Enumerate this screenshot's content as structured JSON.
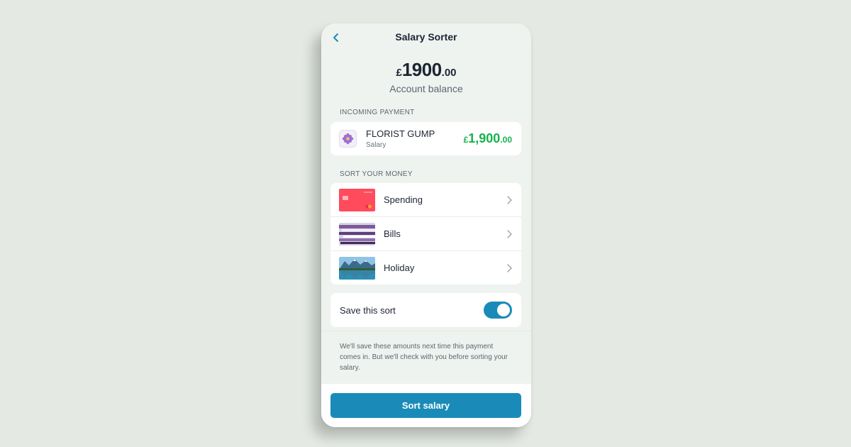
{
  "header": {
    "title": "Salary Sorter",
    "back_icon": "chevron-left-icon"
  },
  "balance": {
    "currency": "£",
    "whole": "1900",
    "pence": ".00",
    "label": "Account balance"
  },
  "incoming": {
    "section_label": "INCOMING PAYMENT",
    "payee": "FLORIST GUMP",
    "category": "Salary",
    "icon": "flower-icon",
    "amount_currency": "£",
    "amount_whole": "1,900",
    "amount_pence": ".00",
    "amount_color": "#16b24c"
  },
  "sort": {
    "section_label": "SORT YOUR MONEY",
    "items": [
      {
        "label": "Spending",
        "thumb": "card-thumbnail"
      },
      {
        "label": "Bills",
        "thumb": "bills-thumbnail"
      },
      {
        "label": "Holiday",
        "thumb": "lake-thumbnail"
      }
    ]
  },
  "save": {
    "label": "Save this sort",
    "enabled": true
  },
  "note": "We'll save these amounts next time this payment comes in. But we'll check with you before sorting your salary.",
  "cta": {
    "label": "Sort salary",
    "color": "#1a8bb8"
  },
  "thumb_badge": "monzo"
}
